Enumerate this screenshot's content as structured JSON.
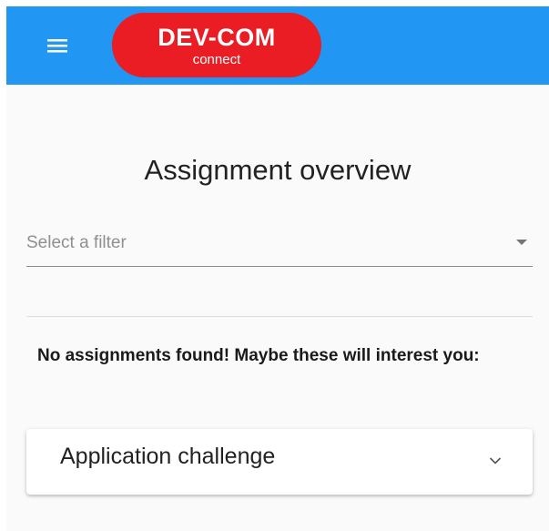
{
  "app_bar": {
    "background_color": "#2196f3",
    "menu_icon": "hamburger-menu-icon",
    "logo": {
      "title": "DEV-COM",
      "subtitle": "connect",
      "background_color": "#ea1c24"
    }
  },
  "main": {
    "title": "Assignment overview",
    "filter": {
      "placeholder": "Select a filter",
      "icon": "dropdown-arrow-icon"
    },
    "empty_message": "No assignments found! Maybe these will interest you:",
    "suggestions": [
      {
        "title": "Application challenge",
        "icon": "chevron-down-icon"
      }
    ]
  }
}
